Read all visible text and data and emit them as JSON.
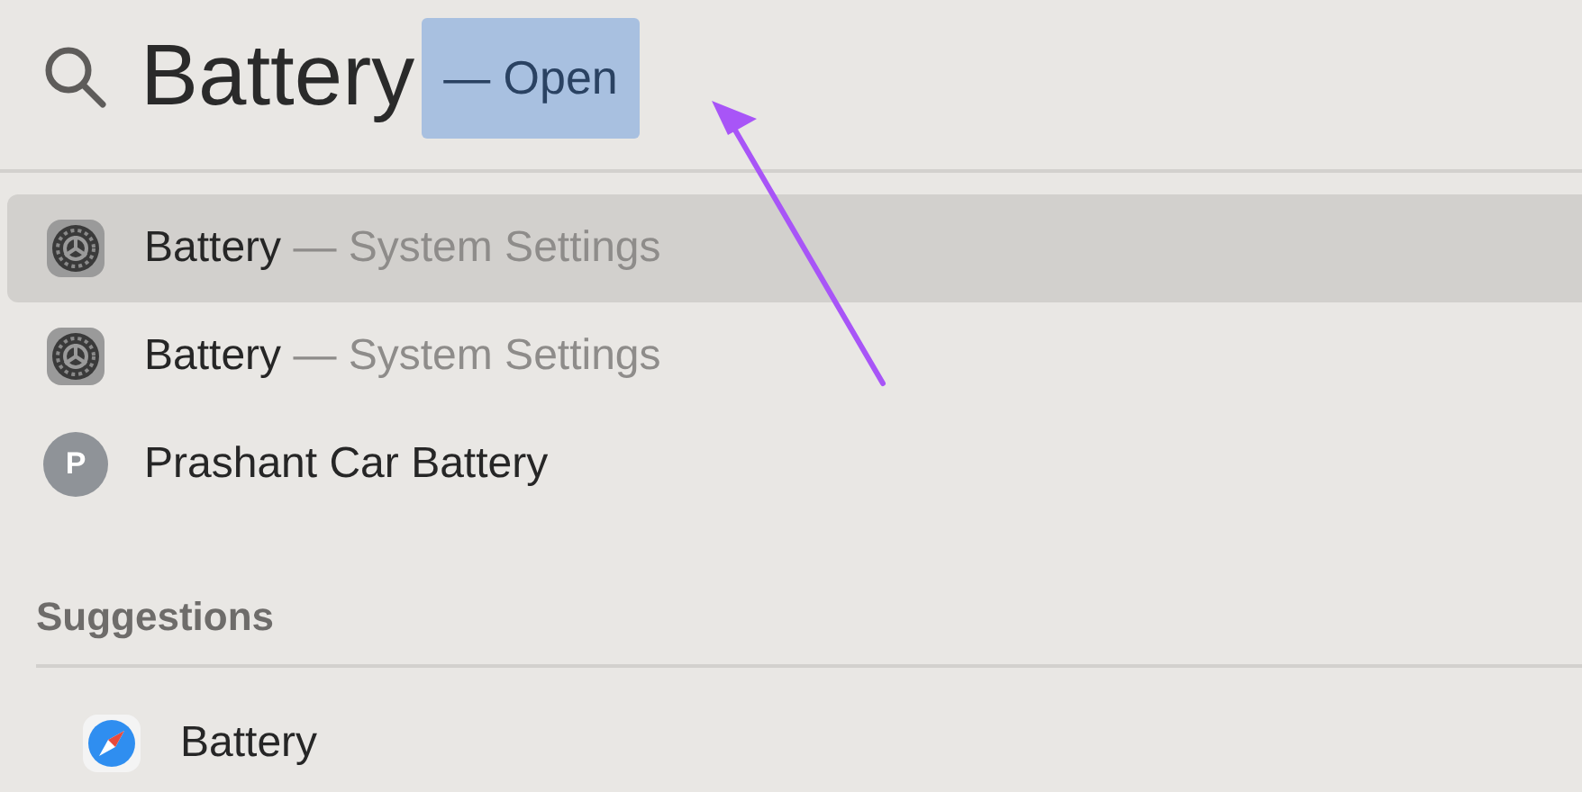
{
  "search": {
    "query": "Battery",
    "completion": "— Open"
  },
  "results": [
    {
      "kind": "app",
      "title": "Battery",
      "subtitle": "— System Settings",
      "selected": true
    },
    {
      "kind": "app",
      "title": "Battery",
      "subtitle": "— System Settings",
      "selected": false
    },
    {
      "kind": "contact",
      "title": "Prashant Car Battery",
      "initial": "P",
      "selected": false
    }
  ],
  "suggestions": {
    "heading": "Suggestions",
    "items": [
      {
        "kind": "web",
        "title": "Battery",
        "selected": false
      }
    ]
  }
}
